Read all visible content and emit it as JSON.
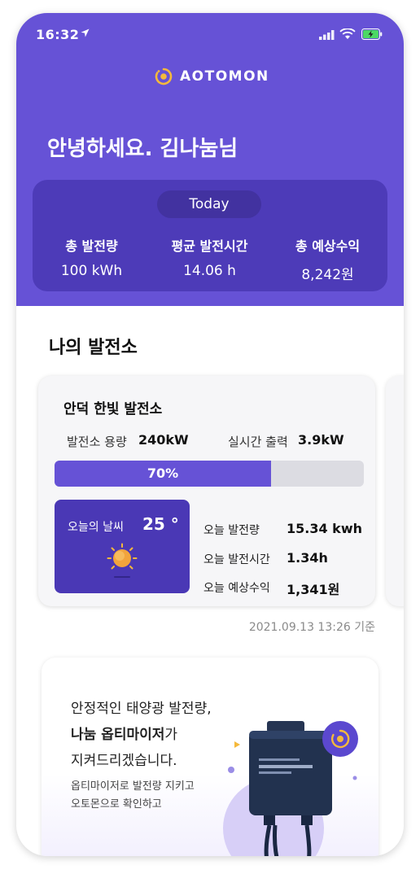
{
  "status_bar": {
    "time": "16:32"
  },
  "brand": {
    "name": "AOTOMON"
  },
  "greeting": "안녕하세요. 김나눔님",
  "summary": {
    "period": "Today",
    "stats": [
      {
        "label": "총 발전량",
        "value": "100 kWh"
      },
      {
        "label": "평균 발전시간",
        "value": "14.06 h"
      },
      {
        "label": "총 예상수익",
        "value": "8,242원"
      }
    ]
  },
  "section": {
    "title": "나의 발전소"
  },
  "plant": {
    "name": "안덕 한빛 발전소",
    "capacity_label": "발전소 용량",
    "capacity_value": "240kW",
    "output_label": "실시간 출력",
    "output_value": "3.9kW",
    "progress_label": "70%",
    "progress_percent": 70,
    "weather": {
      "label": "오늘의 날씨",
      "temperature": "25 °",
      "icon": "sun-icon"
    },
    "metrics": [
      {
        "label": "오늘 발전량",
        "value": "15.34 kwh"
      },
      {
        "label": "오늘 발전시간",
        "value": "1.34h"
      },
      {
        "label": "오늘 예상수익",
        "value": "1,341원"
      }
    ],
    "updated": "2021.09.13 13:26 기준"
  },
  "promo": {
    "line1": "안정적인 태양광 발전량,",
    "line2_bold": "나눔 옵티마이저",
    "line2_suffix": "가",
    "line3": "지켜드리겠습니다.",
    "sub1": "옵티마이저로 발전량 지키고",
    "sub2": "오토몬으로 확인하고"
  },
  "colors": {
    "primary": "#6652d6",
    "primary_dark": "#4d3bb8",
    "sun": "#f2a43c",
    "battery": "#4cd964"
  }
}
